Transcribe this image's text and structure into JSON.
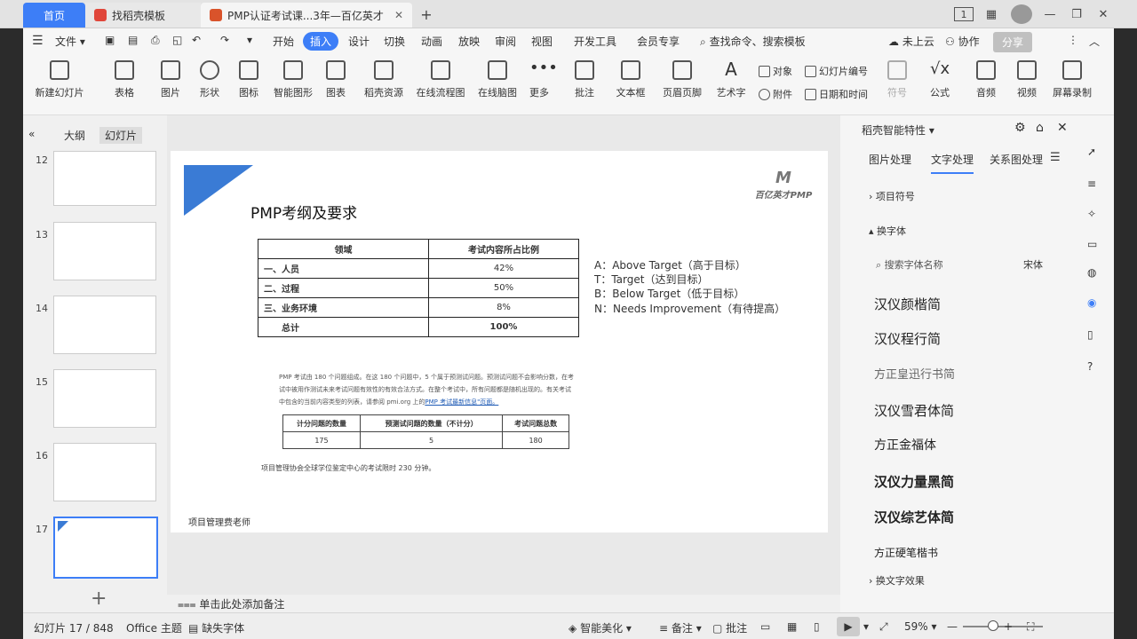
{
  "tabs": {
    "home": "首页",
    "template": "找稻壳模板",
    "doc": "PMP认证考试课...3年—百亿英才"
  },
  "window": {
    "badge": "1"
  },
  "menu": {
    "file": "文件",
    "items": [
      "开始",
      "插入",
      "设计",
      "切换",
      "动画",
      "放映",
      "审阅",
      "视图",
      "开发工具",
      "会员专享"
    ],
    "search": "查找命令、搜索模板",
    "cloud": "未上云",
    "collab": "协作",
    "share": "分享"
  },
  "ribbon": {
    "big": [
      "新建幻灯片",
      "表格",
      "图片",
      "形状",
      "图标",
      "智能图形",
      "图表",
      "稻壳资源",
      "在线流程图",
      "在线脑图",
      "更多",
      "批注",
      "文本框",
      "页眉页脚",
      "艺术字"
    ],
    "small_top": [
      "对象",
      "幻灯片编号"
    ],
    "small_bottom": [
      "附件",
      "日期和时间"
    ],
    "right": [
      "符号",
      "公式",
      "音频",
      "视频",
      "屏幕录制"
    ]
  },
  "slidepanel": {
    "outline": "大纲",
    "slides": "幻灯片",
    "numbers": [
      "12",
      "13",
      "14",
      "15",
      "16",
      "17"
    ],
    "add": "+"
  },
  "slide": {
    "logo_text": "百亿英才PMP",
    "title": "PMP考纲及要求",
    "table1": {
      "headers": [
        "领域",
        "考试内容所占比例"
      ],
      "rows": [
        [
          "一、人员",
          "42%"
        ],
        [
          "二、过程",
          "50%"
        ],
        [
          "三、业务环境",
          "8%"
        ],
        [
          "总计",
          "100%"
        ]
      ]
    },
    "legend": [
      "A：Above Target（高于目标）",
      "T：Target（达到目标）",
      "B：Below Target（低于目标）",
      "N：Needs Improvement（有待提高）"
    ],
    "paragraph_lines": [
      "PMP 考试由 180 个问题组成。在这 180 个问题中，5 个属于预测试问题。预测试问题不会影响分数，在考",
      "试中被用作测试未来考试问题有效性的有效合法方式。在整个考试中，所有问题都是随机出现的。有关考试",
      "中包含的当前内容类型的列表，请参阅 pmi.org 上的"
    ],
    "paragraph_link": "PMP 考试最新信息\"页面。",
    "table2": {
      "headers": [
        "计分问题的数量",
        "预测试问题的数量（不计分）",
        "考试问题总数"
      ],
      "values": [
        "175",
        "5",
        "180"
      ]
    },
    "footnote": "项目管理协会全球学位鉴定中心的考试限时 230 分钟。",
    "teacher": "项目管理费老师"
  },
  "rightpane": {
    "header": "稻壳智能特性",
    "tabs": [
      "图片处理",
      "文字处理",
      "关系图处理"
    ],
    "bullet": "项目符号",
    "fontswap": "换字体",
    "search_placeholder": "搜索字体名称",
    "current_font": "宋体",
    "samples": [
      "汉仪颜楷简",
      "汉仪程行简",
      "方正皇迅行书简",
      "汉仪雪君体简",
      "方正金福体",
      "汉仪力量黑简",
      "汉仪综艺体简",
      "方正硬笔楷书"
    ],
    "effect": "换文字效果"
  },
  "notes": "单击此处添加备注",
  "status": {
    "slide_count": "幻灯片 17 / 848",
    "theme": "Office 主题",
    "missing_font": "缺失字体",
    "beautify": "智能美化",
    "notes": "备注",
    "comments": "批注",
    "zoom": "59%"
  },
  "colors": {
    "accent": "#3d7ef7",
    "slide_triangle": "#3a7bd5"
  }
}
